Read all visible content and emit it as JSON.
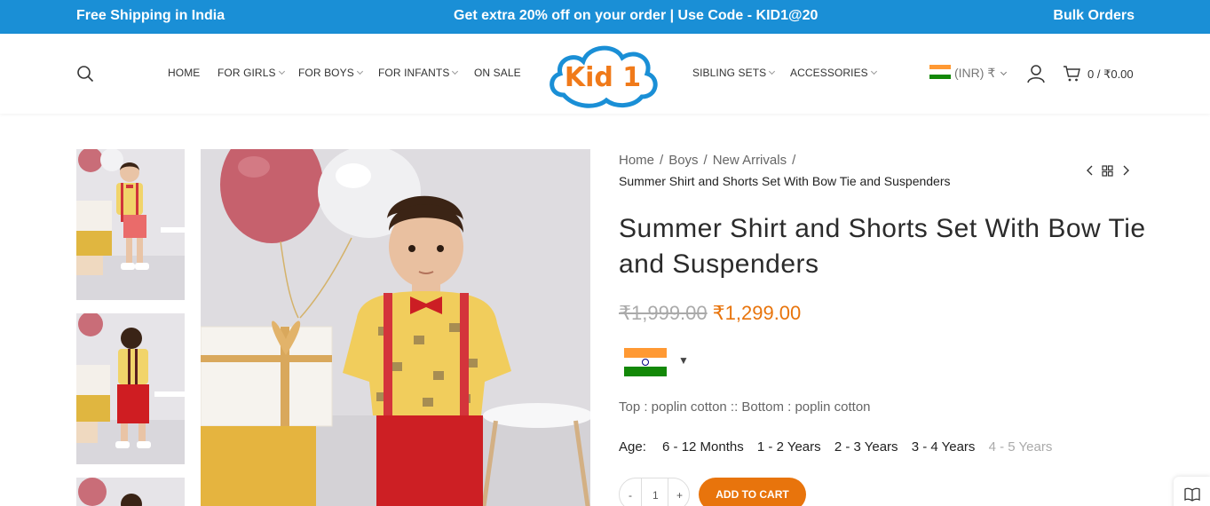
{
  "topbar": {
    "left": "Free Shipping in India",
    "center": "Get extra 20% off on your order | Use Code - KID1@20",
    "right": "Bulk Orders"
  },
  "nav": {
    "left": [
      {
        "label": "HOME",
        "dropdown": false
      },
      {
        "label": "FOR GIRLS",
        "dropdown": true
      },
      {
        "label": "FOR BOYS",
        "dropdown": true
      },
      {
        "label": "FOR INFANTS",
        "dropdown": true
      },
      {
        "label": "ON SALE",
        "dropdown": false
      }
    ],
    "right": [
      {
        "label": "SIBLING SETS",
        "dropdown": true
      },
      {
        "label": "ACCESSORIES",
        "dropdown": true
      }
    ]
  },
  "logo": {
    "text": "Kid 1",
    "icon": "kid1-cloud-logo"
  },
  "currency": {
    "label": "(INR) ₹",
    "icon": "india-flag-icon"
  },
  "cart": {
    "label": "0 / ₹0.00"
  },
  "breadcrumb": {
    "items": [
      "Home",
      "Boys",
      "New Arrivals"
    ],
    "current": "Summer Shirt and Shorts Set With Bow Tie and Suspenders"
  },
  "product": {
    "title": "Summer Shirt and Shorts Set With Bow Tie and Suspenders",
    "old_price": "₹1,999.00",
    "new_price": "₹1,299.00",
    "fabric": "Top : poplin cotton :: Bottom : poplin cotton",
    "age_label": "Age:",
    "ages": [
      {
        "label": "6 - 12 Months",
        "available": true
      },
      {
        "label": "1 - 2 Years",
        "available": true
      },
      {
        "label": "2 - 3 Years",
        "available": true
      },
      {
        "label": "3 - 4 Years",
        "available": true
      },
      {
        "label": "4 - 5 Years",
        "available": false
      }
    ],
    "quantity": {
      "minus": "-",
      "value": "1",
      "plus": "+"
    },
    "add_to_cart": "ADD TO CART"
  },
  "colors": {
    "topbar": "#1a8fd6",
    "accent": "#e8740c",
    "saffron": "#ff9933",
    "green": "#138808"
  }
}
